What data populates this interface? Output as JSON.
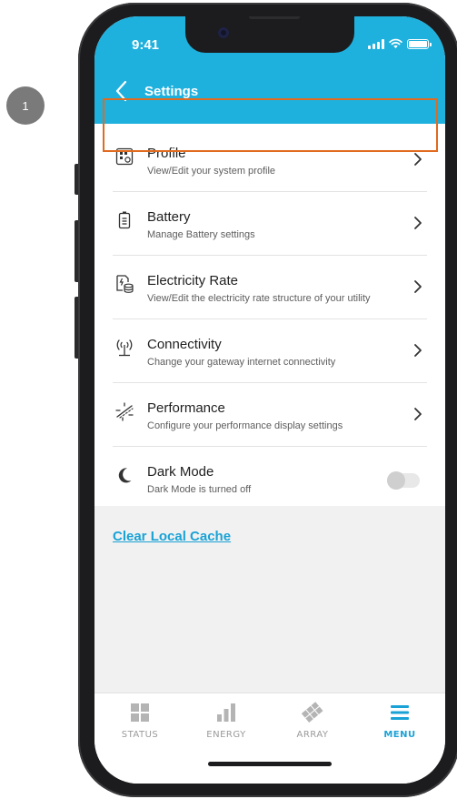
{
  "step_badge": "1",
  "status_bar": {
    "time": "9:41"
  },
  "header": {
    "title": "Settings"
  },
  "settings": {
    "items": [
      {
        "title": "Profile",
        "subtitle": "View/Edit your system profile"
      },
      {
        "title": "Battery",
        "subtitle": "Manage Battery settings"
      },
      {
        "title": "Electricity Rate",
        "subtitle": "View/Edit the electricity rate structure of your utility"
      },
      {
        "title": "Connectivity",
        "subtitle": "Change your gateway internet connectivity"
      },
      {
        "title": "Performance",
        "subtitle": "Configure your performance display settings"
      },
      {
        "title": "Dark Mode",
        "subtitle": "Dark Mode is turned off"
      }
    ]
  },
  "dark_mode_enabled": false,
  "clear_cache_label": "Clear Local Cache",
  "tabbar": {
    "tabs": [
      {
        "label": "STATUS"
      },
      {
        "label": "ENERGY"
      },
      {
        "label": "ARRAY"
      },
      {
        "label": "MENU"
      }
    ],
    "active": "MENU"
  },
  "colors": {
    "header": "#1fb1dd",
    "accent": "#1aa2d6",
    "highlight": "#e06a1f"
  },
  "icons": [
    "profile-icon",
    "battery-icon",
    "electricity-rate-icon",
    "connectivity-icon",
    "performance-icon",
    "moon-icon",
    "chevron-right-icon",
    "back-chevron-icon",
    "status-icon",
    "energy-icon",
    "array-icon",
    "menu-icon"
  ]
}
